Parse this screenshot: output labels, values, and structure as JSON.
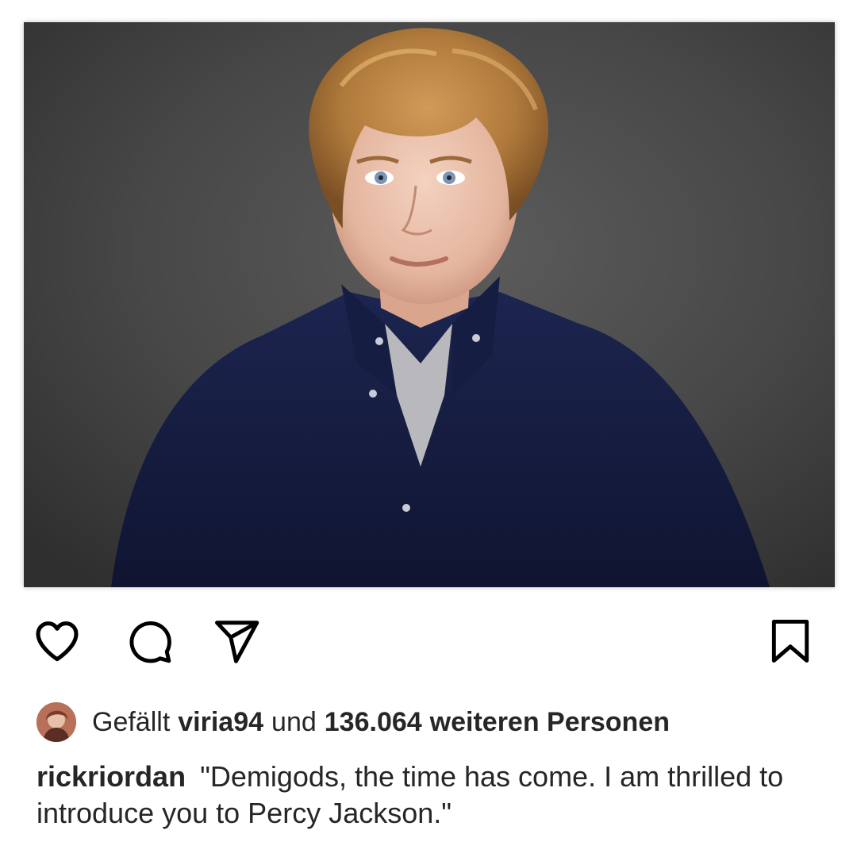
{
  "post": {
    "image_alt": "Portrait photo of a boy with wavy blond hair wearing a dark navy button-down shirt over a grey t-shirt",
    "colors": {
      "background": "#ffffff",
      "text": "#262626",
      "shirt": "#141a3a",
      "hair": "#b07a3c",
      "backdrop": "#454545"
    }
  },
  "actions": {
    "like_icon": "heart-icon",
    "comment_icon": "comment-bubble-icon",
    "share_icon": "paper-plane-icon",
    "save_icon": "bookmark-icon"
  },
  "likes": {
    "prefix": "Gefällt",
    "first_user": "viria94",
    "connector": "und",
    "count": "136.064",
    "suffix": "weiteren Personen"
  },
  "caption": {
    "username": "rickriordan",
    "text": "\"Demigods, the time has come. I am thrilled to introduce you to Percy Jackson.\""
  }
}
